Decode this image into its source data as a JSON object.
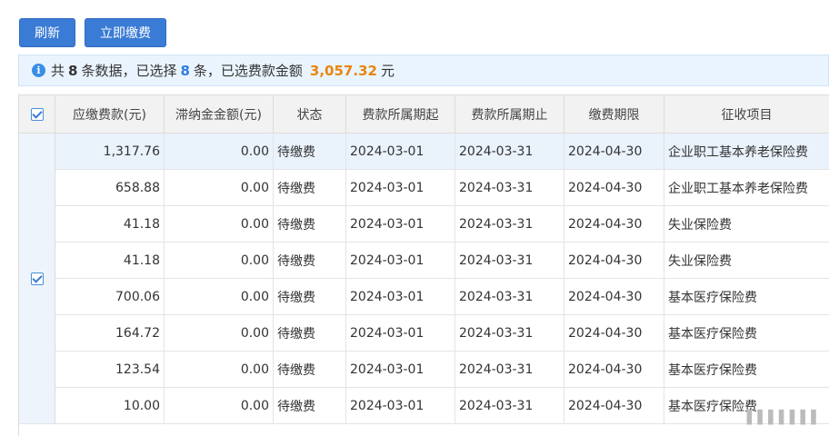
{
  "toolbar": {
    "refresh_label": "刷新",
    "pay_now_label": "立即缴费"
  },
  "info": {
    "prefix": "共",
    "total": "8",
    "mid": "条数据，已选择",
    "selected": "8",
    "mid2": "条，已选费款金额",
    "amount": "3,057.32",
    "unit": "元"
  },
  "table": {
    "headers": [
      "应缴费款(元)",
      "滞纳金金额(元)",
      "状态",
      "费款所属期起",
      "费款所属期止",
      "缴费期限",
      "征收项目"
    ],
    "rows": [
      [
        "1,317.76",
        "0.00",
        "待缴费",
        "2024-03-01",
        "2024-03-31",
        "2024-04-30",
        "企业职工基本养老保险费"
      ],
      [
        "658.88",
        "0.00",
        "待缴费",
        "2024-03-01",
        "2024-03-31",
        "2024-04-30",
        "企业职工基本养老保险费"
      ],
      [
        "41.18",
        "0.00",
        "待缴费",
        "2024-03-01",
        "2024-03-31",
        "2024-04-30",
        "失业保险费"
      ],
      [
        "41.18",
        "0.00",
        "待缴费",
        "2024-03-01",
        "2024-03-31",
        "2024-04-30",
        "失业保险费"
      ],
      [
        "700.06",
        "0.00",
        "待缴费",
        "2024-03-01",
        "2024-03-31",
        "2024-04-30",
        "基本医疗保险费"
      ],
      [
        "164.72",
        "0.00",
        "待缴费",
        "2024-03-01",
        "2024-03-31",
        "2024-04-30",
        "基本医疗保险费"
      ],
      [
        "123.54",
        "0.00",
        "待缴费",
        "2024-03-01",
        "2024-03-31",
        "2024-04-30",
        "基本医疗保险费"
      ],
      [
        "10.00",
        "0.00",
        "待缴费",
        "2024-03-01",
        "2024-03-31",
        "2024-04-30",
        "基本医疗保险费"
      ]
    ]
  },
  "icons": {
    "info": "info-icon",
    "checkbox": "checkbox-checked-icon"
  },
  "colors": {
    "accent": "#3a7bd5",
    "amount": "#e8850c",
    "selected_row": "#eaf2fc"
  }
}
